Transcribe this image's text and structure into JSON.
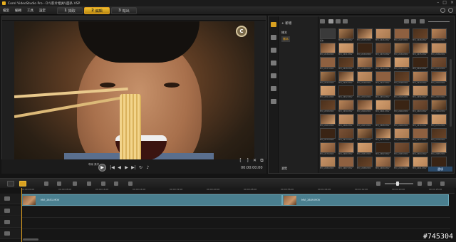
{
  "app": {
    "title": "Corel VideoStudio Pro - D:\\\\影片相关\\\\面条.VSP"
  },
  "menu": [
    "檔案",
    "編輯",
    "工具",
    "設定"
  ],
  "steps": [
    {
      "num": "1",
      "label": "擷取",
      "active": false
    },
    {
      "num": "2",
      "label": "編輯",
      "active": true
    },
    {
      "num": "3",
      "label": "輸出",
      "active": false
    }
  ],
  "player": {
    "mode_label": "專案\n素材",
    "timecode": "00:00:00:00",
    "badge": "C"
  },
  "library": {
    "add_label": "新增",
    "folders": [
      "樣本",
      "樣本"
    ],
    "browse_label": "瀏覽",
    "bottom_label": "選項",
    "thumbs": [
      "樣本",
      "MVI_2424.MOV",
      "MVI_2425.MOV",
      "MVI_2426.MOV",
      "MVI_2427.MOV",
      "MVI_2428.MOV",
      "MVI_2429.MOV",
      "MVI_2430.MOV",
      "MVI_2431.MOV",
      "MVI_2432.MOV",
      "MVI_2433.MOV",
      "MVI_2434.MOV",
      "MVI_2435.MOV",
      "MVI_2436.MOV",
      "MVI_2437.MOV",
      "MVI_2438.MOV",
      "MVI_2439.MOV",
      "MVI_2440.MOV",
      "MVI_2441.MOV",
      "MVI_2442.MOV",
      "MVI_2443.MOV",
      "MVI_2444.MOV",
      "MVI_2445.MOV",
      "MVI_2446.MOV",
      "MVI_2447.MOV",
      "MVI_2448.MOV",
      "MVI_2449.MOV",
      "MVI_2450.MOV",
      "MVI_2451.MOV",
      "MVI_2452.MOV",
      "MVI_2453.MOV",
      "MVI_2454.MOV",
      "MVI_2455.MOV",
      "MVI_2456.MOV",
      "MVI_2457.MOV",
      "MVI_2458.MOV",
      "MVI_2459.MOV",
      "MVI_2460.MOV",
      "MVI_2461.MOV",
      "MVI_2462.MOV",
      "MVI_2463.MOV",
      "MVI_2464.MOV",
      "MVI_2465.MOV",
      "MVI_2466.MOV",
      "MVI_2467.MOV",
      "MVI_2468.MOV",
      "MVI_2469.MOV",
      "MVI_2470.MOV",
      "MVI_2471.MOV",
      "MVI_2472.MOV",
      "MVI_2473.MOV",
      "MVI_2474.MOV",
      "MVI_2475.MOV",
      "MVI_2476.MOV",
      "MVI_2477.MOV",
      "MVI_2478.MOV",
      "MVI_2479.MOV",
      "MVI_2480.MOV",
      "MVI_2481.MOV",
      "MVI_2482.MOV",
      "MVI_2483.MOV",
      "MVI_2484.MOV",
      "MVI_2485.MOV",
      "MVI_2486.MOV",
      "MVI_2487.MOV",
      "MVI_2488.MOV",
      "MVI_2489.MOV",
      "MVI_2490.MOV",
      "MVI_2491.MOV",
      "MVI_2492.MOV",
      "MVI_2493.MOV",
      "MVI_2494.MOV",
      "MVI_2495.MOV",
      "MVI_2496.MOV",
      "MVI_2497.MOV",
      "MVI_2498.MOV",
      "MVI_2499.MOV"
    ]
  },
  "timeline": {
    "ticks": [
      "00:00:00:00",
      "00:00:08:00",
      "00:00:16:00",
      "00:00:24:00",
      "00:00:32:00",
      "00:00:40:00",
      "00:00:48:00",
      "00:00:56:00",
      "00:01:04:00",
      "00:01:12:00",
      "00:01:20:00",
      "00:01:28:00"
    ],
    "clips": [
      {
        "label": "MVI_2651.MOV"
      },
      {
        "label": "MVI_2649.MOV"
      }
    ]
  },
  "watermark": "#745304",
  "colors": {
    "accent": "#e0a020",
    "clip": "#4a7f8f"
  }
}
